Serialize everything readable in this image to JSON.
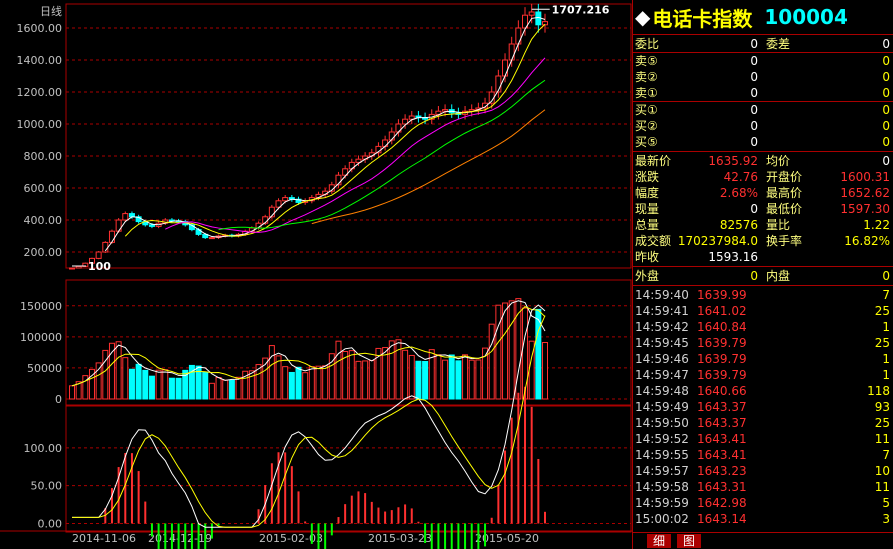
{
  "chart_title": "日线",
  "max_label": "1707.216",
  "min_label": "100",
  "price_axis": {
    "ticks": [
      "1600.00",
      "1400.00",
      "1200.00",
      "1000.00",
      "800.00",
      "600.00",
      "400.00",
      "200.00"
    ],
    "values": [
      1600,
      1400,
      1200,
      1000,
      800,
      600,
      400,
      200
    ],
    "ylim": [
      100,
      1750
    ]
  },
  "volume_axis": {
    "ticks": [
      "150000",
      "100000",
      "50000",
      "0"
    ],
    "values": [
      150000,
      100000,
      50000,
      0
    ],
    "ylim": [
      0,
      185000
    ]
  },
  "macd_axis": {
    "ticks": [
      "100.00",
      "50.00",
      "0.00"
    ],
    "values": [
      100,
      50,
      0
    ],
    "ylim": [
      -10,
      150
    ]
  },
  "date_ticks": [
    "2014-11-06",
    "2014-12-19",
    "2015-02-03",
    "2015-03-23",
    "2015-05-20"
  ],
  "chart_data": {
    "type": "line",
    "title": "日线",
    "series": [
      {
        "values": [
          100,
          110,
          130,
          160,
          200,
          260,
          330,
          400,
          440,
          420,
          390,
          370,
          360,
          380,
          400,
          395,
          390,
          370,
          340,
          310,
          290,
          290,
          300,
          305,
          300,
          310,
          330,
          350,
          380,
          420,
          480,
          520,
          540,
          530,
          510,
          520,
          540,
          560,
          580,
          620,
          680,
          720,
          760,
          780,
          800,
          820,
          860,
          900,
          950,
          1000,
          1030,
          1050,
          1040,
          1030,
          1060,
          1080,
          1090,
          1070,
          1060,
          1080,
          1090,
          1100,
          1130,
          1200,
          1300,
          1400,
          1500,
          1600,
          1680,
          1700,
          1620,
          1640
        ]
      }
    ]
  },
  "side": {
    "flag": "◆",
    "name": "电话卡指数",
    "code": "100004",
    "order": [
      {
        "label": "委比",
        "value": "0",
        "label2": "委差",
        "value2": "0"
      },
      {
        "label": "卖⑤",
        "value": "0",
        "value2": "0"
      },
      {
        "label": "卖②",
        "value": "0",
        "value2": "0"
      },
      {
        "label": "卖①",
        "value": "0",
        "value2": "0"
      },
      {
        "label": "买①",
        "value": "0",
        "value2": "0"
      },
      {
        "label": "买②",
        "value": "0",
        "value2": "0"
      },
      {
        "label": "买⑤",
        "value": "0",
        "value2": "0"
      }
    ],
    "quote": [
      {
        "label": "最新价",
        "value": "1635.92",
        "label2": "均价",
        "value2": "0"
      },
      {
        "label": "涨跌",
        "value": "42.76",
        "label2": "开盘价",
        "value2": "1600.31"
      },
      {
        "label": "幅度",
        "value": "2.68%",
        "label2": "最高价",
        "value2": "1652.62"
      },
      {
        "label": "现量",
        "value": "0",
        "label2": "最低价",
        "value2": "1597.30"
      },
      {
        "label": "总量",
        "value": "82576",
        "label2": "量比",
        "value2": "1.22"
      },
      {
        "label": "成交额",
        "value": "170237984.0",
        "label2": "换手率",
        "value2": "16.82%"
      },
      {
        "label": "昨收",
        "value": "1593.16"
      }
    ],
    "outer": {
      "label": "外盘",
      "value": "0",
      "label2": "内盘",
      "value2": "0"
    },
    "ticks": [
      {
        "time": "14:59:40",
        "price": "1639.99",
        "vol": "7"
      },
      {
        "time": "14:59:41",
        "price": "1641.02",
        "vol": "25"
      },
      {
        "time": "14:59:42",
        "price": "1640.84",
        "vol": "1"
      },
      {
        "time": "14:59:45",
        "price": "1639.79",
        "vol": "25"
      },
      {
        "time": "14:59:46",
        "price": "1639.79",
        "vol": "1"
      },
      {
        "time": "14:59:47",
        "price": "1639.79",
        "vol": "1"
      },
      {
        "time": "14:59:48",
        "price": "1640.66",
        "vol": "118"
      },
      {
        "time": "14:59:49",
        "price": "1643.37",
        "vol": "93"
      },
      {
        "time": "14:59:50",
        "price": "1643.37",
        "vol": "25"
      },
      {
        "time": "14:59:52",
        "price": "1643.41",
        "vol": "11"
      },
      {
        "time": "14:59:55",
        "price": "1643.41",
        "vol": "7"
      },
      {
        "time": "14:59:57",
        "price": "1643.23",
        "vol": "10"
      },
      {
        "time": "14:59:58",
        "price": "1643.31",
        "vol": "11"
      },
      {
        "time": "14:59:59",
        "price": "1642.98",
        "vol": "5"
      },
      {
        "time": "15:00:02",
        "price": "1643.14",
        "vol": "3"
      }
    ],
    "tabs": [
      "细",
      "图"
    ]
  }
}
